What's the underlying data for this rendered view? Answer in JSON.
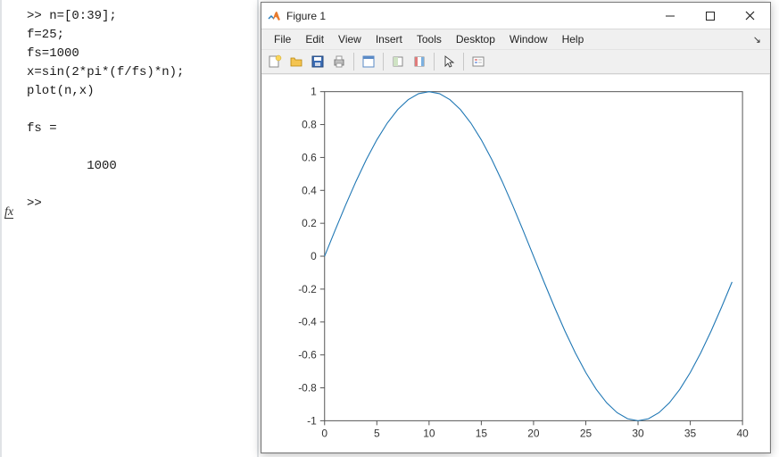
{
  "command_window": {
    "lines": [
      ">> n=[0:39];",
      "f=25;",
      "fs=1000",
      "x=sin(2*pi*(f/fs)*n);",
      "plot(n,x)",
      "",
      "fs =",
      "",
      "        1000",
      "",
      ">> "
    ],
    "fx_label": "fx"
  },
  "figure": {
    "title": "Figure 1",
    "menus": [
      "File",
      "Edit",
      "View",
      "Insert",
      "Tools",
      "Desktop",
      "Window",
      "Help"
    ],
    "menu_right_glyph": "↘",
    "toolbar_icons": [
      "new-figure-icon",
      "open-icon",
      "save-icon",
      "print-icon",
      "sep",
      "datacursor-icon",
      "sep",
      "link-icon",
      "colorbar-icon",
      "sep",
      "pointer-icon",
      "sep",
      "insert-legend-icon"
    ]
  },
  "chart_data": {
    "type": "line",
    "title": "",
    "xlabel": "",
    "ylabel": "",
    "xlim": [
      0,
      40
    ],
    "ylim": [
      -1,
      1
    ],
    "xticks": [
      0,
      5,
      10,
      15,
      20,
      25,
      30,
      35,
      40
    ],
    "yticks": [
      -1,
      -0.8,
      -0.6,
      -0.4,
      -0.2,
      0,
      0.2,
      0.4,
      0.6,
      0.8,
      1
    ],
    "x": [
      0,
      1,
      2,
      3,
      4,
      5,
      6,
      7,
      8,
      9,
      10,
      11,
      12,
      13,
      14,
      15,
      16,
      17,
      18,
      19,
      20,
      21,
      22,
      23,
      24,
      25,
      26,
      27,
      28,
      29,
      30,
      31,
      32,
      33,
      34,
      35,
      36,
      37,
      38,
      39
    ],
    "values": [
      0.0,
      0.1564,
      0.309,
      0.454,
      0.5878,
      0.7071,
      0.809,
      0.891,
      0.9511,
      0.9877,
      1.0,
      0.9877,
      0.9511,
      0.891,
      0.809,
      0.7071,
      0.5878,
      0.454,
      0.309,
      0.1564,
      0.0,
      -0.1564,
      -0.309,
      -0.454,
      -0.5878,
      -0.7071,
      -0.809,
      -0.891,
      -0.9511,
      -0.9877,
      -1.0,
      -0.9877,
      -0.9511,
      -0.891,
      -0.809,
      -0.7071,
      -0.5878,
      -0.454,
      -0.309,
      -0.1564
    ]
  }
}
